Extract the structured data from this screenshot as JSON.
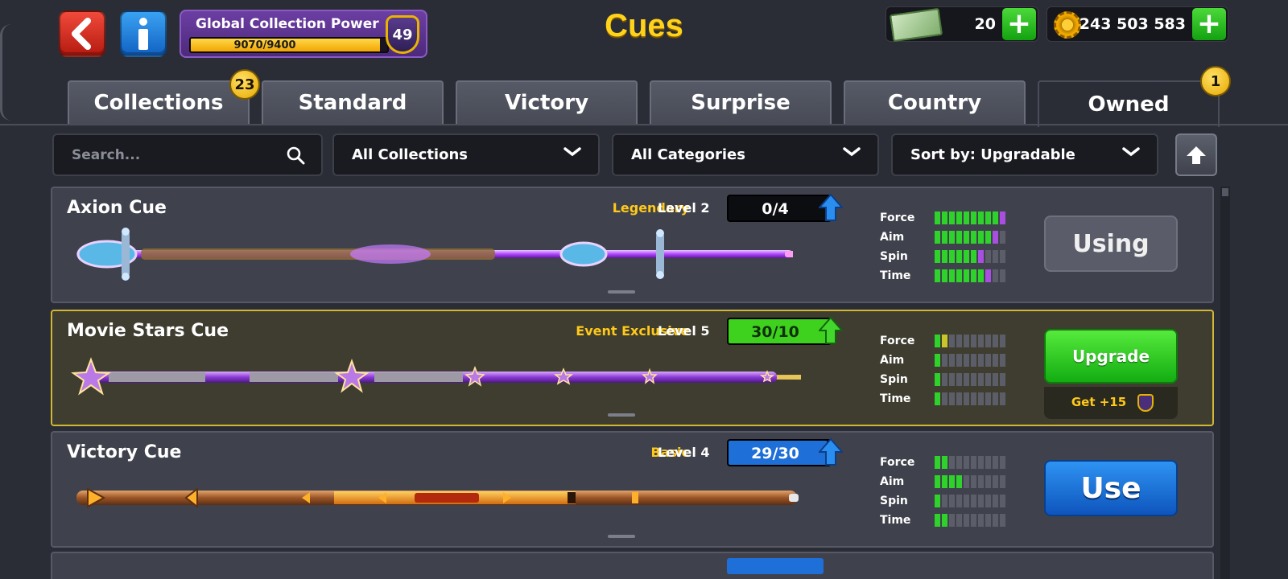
{
  "header": {
    "title": "Cues",
    "back_icon": "back-arrow-icon",
    "info_icon": "info-icon",
    "collection_power": {
      "label": "Global Collection Power",
      "current": 9070,
      "max": 9400,
      "text": "9070/9400",
      "level": "49"
    },
    "cash": {
      "value": "20",
      "icon": "cash-icon"
    },
    "coins": {
      "value": "243 503 583",
      "icon": "coin-icon"
    }
  },
  "tabs": [
    {
      "label": "Collections",
      "badge": "23"
    },
    {
      "label": "Standard"
    },
    {
      "label": "Victory"
    },
    {
      "label": "Surprise"
    },
    {
      "label": "Country"
    },
    {
      "label": "Owned",
      "badge": "1",
      "active": true
    }
  ],
  "filters": {
    "search_placeholder": "Search...",
    "collections": "All Collections",
    "categories": "All Categories",
    "sort": "Sort by: Upgradable"
  },
  "stat_labels": [
    "Force",
    "Aim",
    "Spin",
    "Time"
  ],
  "cues": [
    {
      "name": "Axion Cue",
      "rarity": "Legendary",
      "level": "Level 2",
      "progress_text": "0/4",
      "progress": 0,
      "progress_color": "#1e6fd8",
      "action": "Using",
      "stats": {
        "force": [
          9,
          1
        ],
        "aim": [
          8,
          1
        ],
        "spin": [
          6,
          1
        ],
        "time": [
          7,
          1
        ]
      }
    },
    {
      "name": "Movie Stars Cue",
      "rarity": "Event Exclusive",
      "level": "Level 5",
      "progress_text": "30/10",
      "progress": 1,
      "progress_color": "#3ed21f",
      "action": "Upgrade",
      "action_sub": "Get +15",
      "stats": {
        "force": [
          1,
          0
        ],
        "aim": [
          1,
          0
        ],
        "spin": [
          1,
          0
        ],
        "time": [
          1,
          0
        ]
      }
    },
    {
      "name": "Victory Cue",
      "rarity": "Basic",
      "level": "Level 4",
      "progress_text": "29/30",
      "progress": 0.967,
      "progress_color": "#1e6fd8",
      "action": "Use",
      "stats": {
        "force": [
          2,
          0
        ],
        "aim": [
          4,
          0
        ],
        "spin": [
          1,
          0
        ],
        "time": [
          2,
          0
        ]
      }
    }
  ]
}
